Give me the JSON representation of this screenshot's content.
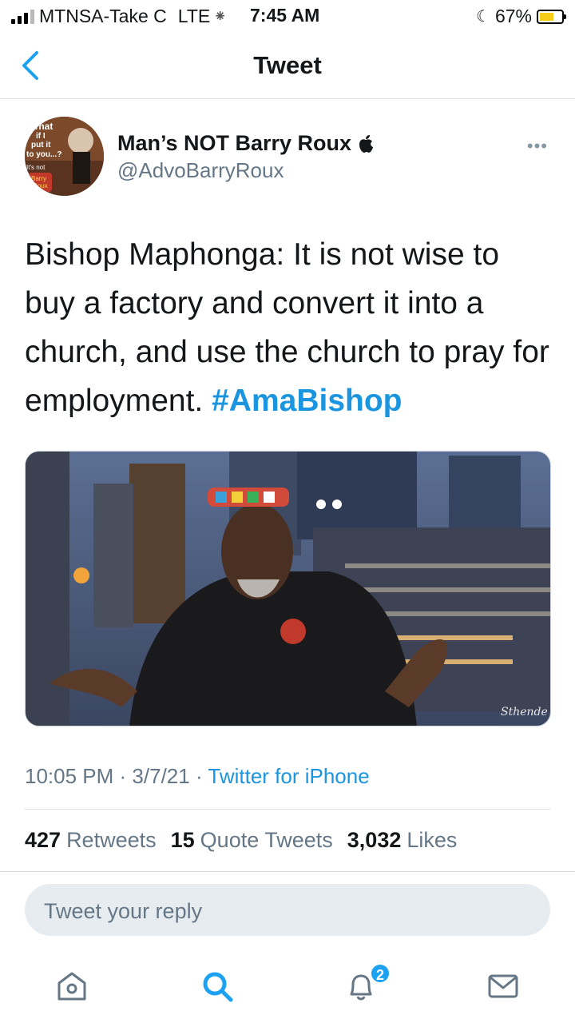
{
  "status_bar": {
    "carrier": "MTNSA-Take C",
    "network": "LTE",
    "time": "7:45 AM",
    "battery": "67%",
    "battery_level": 0.67,
    "battery_color": "#f7cd1a"
  },
  "nav": {
    "title": "Tweet",
    "back_icon": "chevron-left-icon"
  },
  "tweet": {
    "display_name": "Man’s NOT Barry Roux",
    "username": "@AdvoBarryRoux",
    "more_icon": "ellipsis-icon",
    "text": "Bishop Maphonga: It is not wise to buy a factory and convert it into a church, and use the church to pray for employment.",
    "hashtag": "#AmaBishop",
    "avatar_text": {
      "line1": "What",
      "line2": "if I",
      "line3": "put it",
      "line4": "to you...?",
      "line5": "It's not",
      "line6": "Barry",
      "line7": "Roux"
    },
    "media_watermark": "Sthende",
    "time": "10:05 PM",
    "date": "3/7/21",
    "source": "Twitter for iPhone",
    "retweets_count": "427",
    "retweets_label": "Retweets",
    "quotes_count": "15",
    "quotes_label": "Quote Tweets",
    "likes_count": "3,032",
    "likes_label": "Likes"
  },
  "reply": {
    "placeholder": "Tweet your reply"
  },
  "tab_bar": {
    "items": [
      {
        "icon": "home-icon",
        "active": false
      },
      {
        "icon": "search-icon",
        "active": true
      },
      {
        "icon": "notifications-icon",
        "active": false,
        "badge": "2"
      },
      {
        "icon": "messages-icon",
        "active": false
      }
    ]
  },
  "colors": {
    "accent": "#1da1f2",
    "link": "#1b95e0",
    "secondary_text": "#657786"
  }
}
